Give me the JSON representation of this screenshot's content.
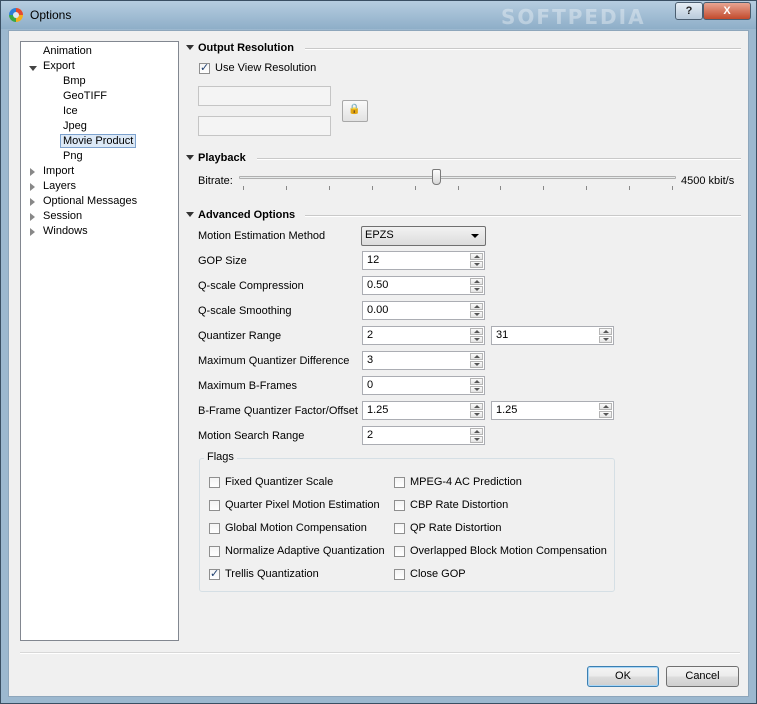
{
  "window": {
    "title": "Options",
    "watermark": "SOFTPEDIA",
    "help_label": "?",
    "close_label": "X"
  },
  "tree": {
    "items": [
      {
        "label": "Animation"
      },
      {
        "label": "Export"
      },
      {
        "label": "Bmp"
      },
      {
        "label": "GeoTIFF"
      },
      {
        "label": "Ice"
      },
      {
        "label": "Jpeg"
      },
      {
        "label": "Movie Product"
      },
      {
        "label": "Png"
      },
      {
        "label": "Import"
      },
      {
        "label": "Layers"
      },
      {
        "label": "Optional Messages"
      },
      {
        "label": "Session"
      },
      {
        "label": "Windows"
      }
    ],
    "selected": "Movie Product"
  },
  "output_resolution": {
    "title": "Output Resolution",
    "use_view_label": "Use View Resolution",
    "use_view_checked": true,
    "width_value": "",
    "height_value": "",
    "lock_icon": "lock-icon"
  },
  "playback": {
    "title": "Playback",
    "bitrate_label": "Bitrate:",
    "bitrate_value": "4500 kbit/s",
    "slider_fraction": 0.45
  },
  "advanced": {
    "title": "Advanced Options",
    "motion_estimation_label": "Motion Estimation Method",
    "motion_estimation_value": "EPZS",
    "gop_size_label": "GOP Size",
    "gop_size_value": "12",
    "qscale_compression_label": "Q-scale Compression",
    "qscale_compression_value": "0.50",
    "qscale_smoothing_label": "Q-scale Smoothing",
    "qscale_smoothing_value": "0.00",
    "quantizer_range_label": "Quantizer Range",
    "quantizer_range_min": "2",
    "quantizer_range_max": "31",
    "max_quantizer_diff_label": "Maximum Quantizer Difference",
    "max_quantizer_diff_value": "3",
    "max_bframes_label": "Maximum B-Frames",
    "max_bframes_value": "0",
    "bframe_factor_label": "B-Frame Quantizer Factor/Offset",
    "bframe_factor_value": "1.25",
    "bframe_offset_value": "1.25",
    "motion_search_range_label": "Motion Search Range",
    "motion_search_range_value": "2"
  },
  "flags": {
    "title": "Flags",
    "left": [
      {
        "label": "Fixed Quantizer Scale",
        "checked": false
      },
      {
        "label": "Quarter Pixel Motion Estimation",
        "checked": false
      },
      {
        "label": "Global Motion Compensation",
        "checked": false
      },
      {
        "label": "Normalize Adaptive Quantization",
        "checked": false
      },
      {
        "label": "Trellis Quantization",
        "checked": true
      }
    ],
    "right": [
      {
        "label": "MPEG-4 AC Prediction",
        "checked": false
      },
      {
        "label": "CBP Rate Distortion",
        "checked": false
      },
      {
        "label": "QP Rate Distortion",
        "checked": false
      },
      {
        "label": "Overlapped Block Motion Compensation",
        "checked": false
      },
      {
        "label": "Close GOP",
        "checked": false
      }
    ]
  },
  "buttons": {
    "ok": "OK",
    "cancel": "Cancel"
  }
}
